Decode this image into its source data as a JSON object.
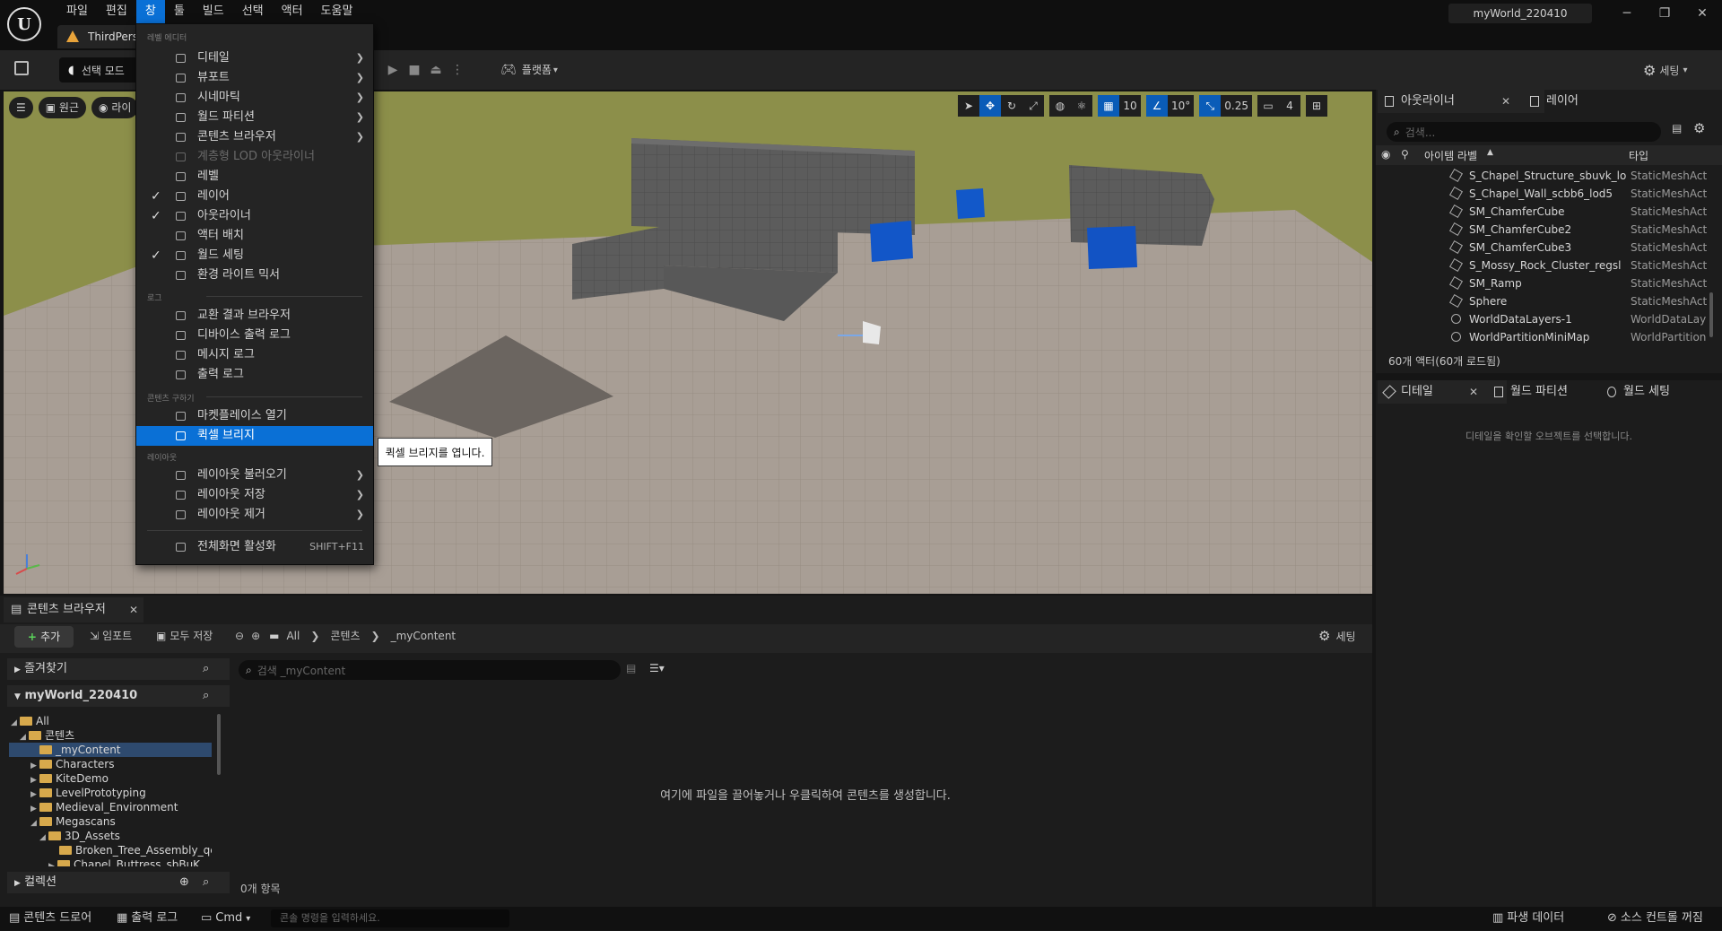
{
  "menubar": {
    "items": [
      "파일",
      "편집",
      "창",
      "툴",
      "빌드",
      "선택",
      "액터",
      "도움말"
    ],
    "active_index": 2
  },
  "window": {
    "project_title": "myWorld_220410",
    "minimize": "─",
    "maximize": "❐",
    "close": "✕"
  },
  "level_tab": "ThirdPers",
  "toolbar": {
    "select_mode": "선택 모드",
    "platform": "플랫폼",
    "settings": "세팅"
  },
  "viewport": {
    "perspective": "원근",
    "lit": "라이",
    "grid_snap": "10",
    "rotation_snap": "10°",
    "scale_snap": "0.25",
    "camera_speed": "4"
  },
  "window_menu": {
    "section_level_editor": "레벨 에디터",
    "section_log": "로그",
    "section_content_acquisition": "콘텐츠 구하기",
    "section_layout": "레이아웃",
    "items": [
      {
        "label": "디테일",
        "submenu": true
      },
      {
        "label": "뷰포트",
        "submenu": true
      },
      {
        "label": "시네마틱",
        "submenu": true
      },
      {
        "label": "월드 파티션",
        "submenu": true
      },
      {
        "label": "콘텐츠 브라우저",
        "submenu": true
      },
      {
        "label": "계층형 LOD 아웃라이너",
        "disabled": true
      },
      {
        "label": "레벨"
      },
      {
        "label": "레이어",
        "checked": true
      },
      {
        "label": "아웃라이너",
        "checked": true
      },
      {
        "label": "액터 배치"
      },
      {
        "label": "월드 세팅",
        "checked": true
      },
      {
        "label": "환경 라이트 믹서"
      }
    ],
    "log_items": [
      "교환 결과 브라우저",
      "디바이스 출력 로그",
      "메시지 로그",
      "출력 로그"
    ],
    "content_items": [
      "마켓플레이스 열기",
      "퀵셀 브리지"
    ],
    "layout_items": [
      "레이아웃 불러오기",
      "레이아웃 저장",
      "레이아웃 제거"
    ],
    "fullscreen": "전체화면 활성화",
    "fullscreen_shortcut": "SHIFT+F11",
    "tooltip": "퀵셀 브리지를 엽니다."
  },
  "outliner": {
    "tab_outliner": "아웃라이너",
    "tab_layers": "레이어",
    "search_placeholder": "검색...",
    "col_label": "아이템 라벨",
    "col_type": "타입",
    "rows": [
      {
        "name": "S_Chapel_Structure_sbuvk_lo",
        "type": "StaticMeshAct"
      },
      {
        "name": "S_Chapel_Wall_scbb6_lod5",
        "type": "StaticMeshAct"
      },
      {
        "name": "SM_ChamferCube",
        "type": "StaticMeshAct"
      },
      {
        "name": "SM_ChamferCube2",
        "type": "StaticMeshAct"
      },
      {
        "name": "SM_ChamferCube3",
        "type": "StaticMeshAct"
      },
      {
        "name": "S_Mossy_Rock_Cluster_regsl",
        "type": "StaticMeshAct"
      },
      {
        "name": "SM_Ramp",
        "type": "StaticMeshAct"
      },
      {
        "name": "Sphere",
        "type": "StaticMeshAct"
      },
      {
        "name": "WorldDataLayers-1",
        "type": "WorldDataLay"
      },
      {
        "name": "WorldPartitionMiniMap",
        "type": "WorldPartition"
      }
    ],
    "count": "60개 액터(60개 로드됨)"
  },
  "details": {
    "tab_details": "디테일",
    "tab_world_partition": "월드 파티션",
    "tab_world_settings": "월드 세팅",
    "hint": "디테일을 확인할 오브젝트를 선택합니다."
  },
  "content_browser": {
    "tab": "콘텐츠 브라우저",
    "add": "추가",
    "import": "임포트",
    "save_all": "모두 저장",
    "path": [
      "All",
      "콘텐츠",
      "_myContent"
    ],
    "settings": "세팅",
    "favorites": "즐겨찾기",
    "project": "myWorld_220410",
    "tree": [
      {
        "label": "All",
        "depth": 0,
        "open": true
      },
      {
        "label": "콘텐츠",
        "depth": 1,
        "open": true
      },
      {
        "label": "_myContent",
        "depth": 2,
        "selected": true
      },
      {
        "label": "Characters",
        "depth": 2
      },
      {
        "label": "KiteDemo",
        "depth": 2
      },
      {
        "label": "LevelPrototyping",
        "depth": 2
      },
      {
        "label": "Medieval_Environment",
        "depth": 2
      },
      {
        "label": "Megascans",
        "depth": 2,
        "open": true
      },
      {
        "label": "3D_Assets",
        "depth": 3,
        "open": true
      },
      {
        "label": "Broken_Tree_Assembly_qc",
        "depth": 4
      },
      {
        "label": "Chapel_Buttress_sbBuK",
        "depth": 4
      }
    ],
    "collections": "컬렉션",
    "search_placeholder": "검색 _myContent",
    "empty_message": "여기에 파일을 끌어놓거나 우클릭하여 콘텐츠를 생성합니다.",
    "item_count": "0개 항목"
  },
  "statusbar": {
    "content_drawer": "콘텐츠 드로어",
    "output_log": "출력 로그",
    "cmd": "Cmd",
    "console_placeholder": "콘솔 명령을 입력하세요.",
    "derived_data": "파생 데이터",
    "source_control": "소스 컨트롤 꺼짐"
  }
}
